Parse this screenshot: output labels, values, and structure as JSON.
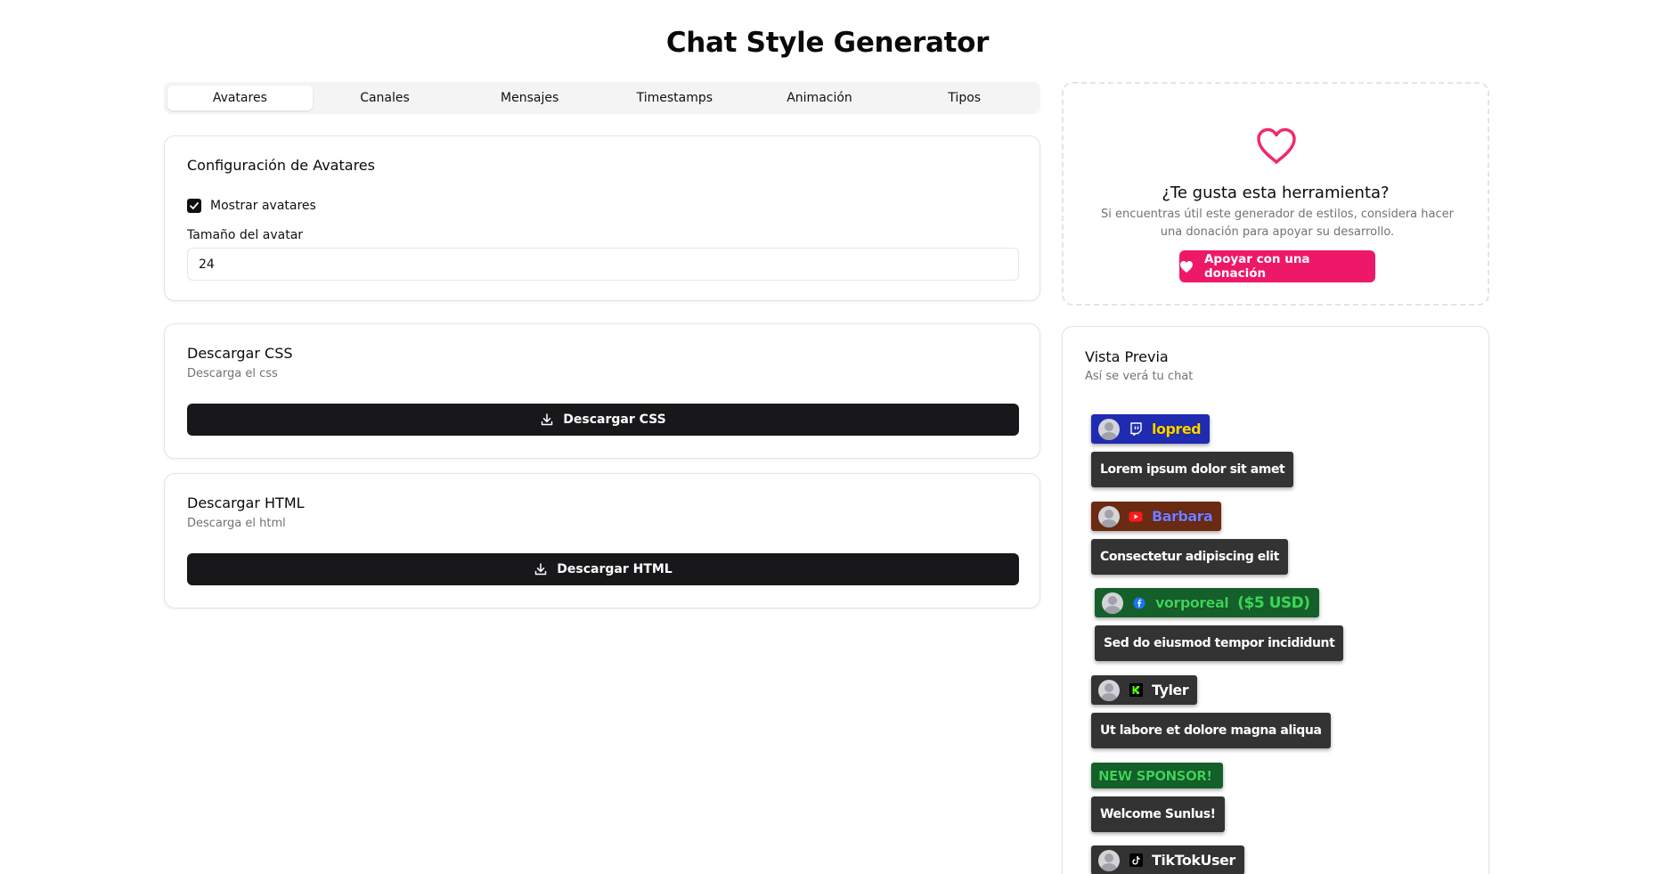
{
  "page": {
    "title": "Chat Style Generator"
  },
  "tabs": [
    {
      "label": "Avatares",
      "active": true
    },
    {
      "label": "Canales",
      "active": false
    },
    {
      "label": "Mensajes",
      "active": false
    },
    {
      "label": "Timestamps",
      "active": false
    },
    {
      "label": "Animación",
      "active": false
    },
    {
      "label": "Tipos",
      "active": false
    }
  ],
  "avatar_config": {
    "title": "Configuración de Avatares",
    "show_avatars_label": "Mostrar avatares",
    "show_avatars_checked": true,
    "size_label": "Tamaño del avatar",
    "size_value": "24"
  },
  "download_css": {
    "title": "Descargar CSS",
    "description": "Descarga el css",
    "button_label": "Descargar CSS",
    "button_icon": "download-icon"
  },
  "download_html": {
    "title": "Descargar HTML",
    "description": "Descarga el html",
    "button_label": "Descargar HTML",
    "button_icon": "download-icon"
  },
  "donation": {
    "icon": "heart-outline-icon",
    "title": "¿Te gusta esta herramienta?",
    "text": "Si encuentras útil este generador de estilos, considera hacer una donación para apoyar su desarrollo.",
    "button_label": "Apoyar con una donación",
    "button_icon": "heart-filled-icon",
    "accent_color": "#ee1868"
  },
  "preview": {
    "title": "Vista Previa",
    "description": "Así se verá tu chat",
    "messages": [
      {
        "platform": "twitch",
        "platform_icon": "twitch-icon",
        "username": "lopred",
        "amount": "",
        "header_bg": "#1f2bb0",
        "username_color": "#ffd400",
        "message": "Lorem ipsum dolor sit amet"
      },
      {
        "platform": "youtube",
        "platform_icon": "youtube-icon",
        "username": "Barbara",
        "amount": "",
        "header_bg": "#6b2a12",
        "username_color": "#7b7bff",
        "message": "Consectetur adipiscing elit"
      },
      {
        "platform": "facebook",
        "platform_icon": "facebook-icon",
        "username": "vorporeal",
        "amount": "($5 USD)",
        "header_bg": "#15602a",
        "username_color": "#3bd65a",
        "message": "Sed do eiusmod tempor incididunt"
      },
      {
        "platform": "kick",
        "platform_icon": "kick-icon",
        "username": "Tyler",
        "amount": "",
        "header_bg": "#333333",
        "username_color": "#ffffff",
        "message": "Ut labore et dolore magna aliqua"
      },
      {
        "platform": "sponsor",
        "platform_icon": "",
        "username": "NEW SPONSOR!",
        "amount": "",
        "header_bg": "#15602a",
        "username_color": "#3bd65a",
        "message": "Welcome Sunlus!"
      },
      {
        "platform": "tiktok",
        "platform_icon": "tiktok-icon",
        "username": "TikTokUser",
        "amount": "",
        "header_bg": "#333333",
        "username_color": "#ffffff",
        "message": ""
      }
    ]
  }
}
